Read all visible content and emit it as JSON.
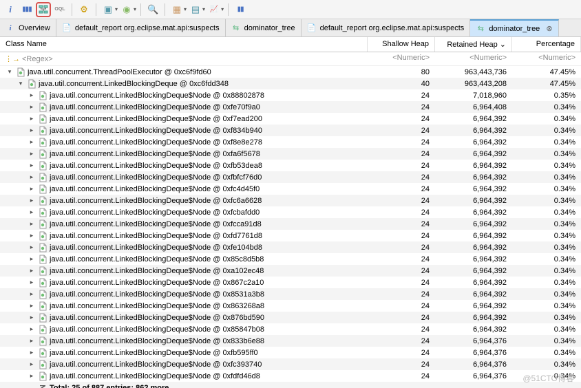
{
  "toolbar": {
    "icons": [
      {
        "name": "info-icon",
        "glyph": "i"
      },
      {
        "name": "histogram-icon",
        "glyph": "▮▮▮"
      },
      {
        "name": "dominator-tree-icon",
        "glyph": "⇆",
        "highlighted": true
      },
      {
        "name": "oql-icon",
        "glyph": "OQL"
      },
      {
        "name": "gear-icon",
        "glyph": "⚙"
      },
      {
        "name": "compare-icon",
        "glyph": "▣"
      },
      {
        "name": "thread-icon",
        "glyph": "◉"
      },
      {
        "name": "search-icon",
        "glyph": "🔍"
      },
      {
        "name": "group-icon",
        "glyph": "▦"
      },
      {
        "name": "calculate-icon",
        "glyph": "▤"
      },
      {
        "name": "chart-icon",
        "glyph": "📈"
      },
      {
        "name": "bar-icon",
        "glyph": "▮▮"
      }
    ]
  },
  "tabs": [
    {
      "icon": "i",
      "label": "Overview",
      "icon_color": "#4a73c4"
    },
    {
      "icon": "📄",
      "label": "default_report  org.eclipse.mat.api:suspects",
      "icon_color": "#6b8"
    },
    {
      "icon": "⇆",
      "label": "dominator_tree",
      "icon_color": "#6b8"
    },
    {
      "icon": "📄",
      "label": "default_report  org.eclipse.mat.api:suspects",
      "icon_color": "#6b8"
    },
    {
      "icon": "⇆",
      "label": "dominator_tree",
      "active": true,
      "closable": true,
      "icon_color": "#6b8"
    }
  ],
  "columns": {
    "name": "Class Name",
    "shallow": "Shallow Heap",
    "retained": "Retained Heap ⌄",
    "percent": "Percentage"
  },
  "filter": {
    "regex": "<Regex>",
    "numeric": "<Numeric>"
  },
  "rows": [
    {
      "indent": 0,
      "exp": "▾",
      "label": "java.util.concurrent.ThreadPoolExecutor @ 0xc6f9fd60",
      "shallow": "80",
      "retained": "963,443,736",
      "percent": "47.45%"
    },
    {
      "indent": 1,
      "exp": "▾",
      "label": "java.util.concurrent.LinkedBlockingDeque @ 0xc6fdd348",
      "shallow": "40",
      "retained": "963,443,208",
      "percent": "47.45%"
    },
    {
      "indent": 2,
      "exp": "▸",
      "label": "java.util.concurrent.LinkedBlockingDeque$Node @ 0x88802878",
      "shallow": "24",
      "retained": "7,018,960",
      "percent": "0.35%"
    },
    {
      "indent": 2,
      "exp": "▸",
      "label": "java.util.concurrent.LinkedBlockingDeque$Node @ 0xfe70f9a0",
      "shallow": "24",
      "retained": "6,964,408",
      "percent": "0.34%"
    },
    {
      "indent": 2,
      "exp": "▸",
      "label": "java.util.concurrent.LinkedBlockingDeque$Node @ 0xf7ead200",
      "shallow": "24",
      "retained": "6,964,392",
      "percent": "0.34%"
    },
    {
      "indent": 2,
      "exp": "▸",
      "label": "java.util.concurrent.LinkedBlockingDeque$Node @ 0xf834b940",
      "shallow": "24",
      "retained": "6,964,392",
      "percent": "0.34%"
    },
    {
      "indent": 2,
      "exp": "▸",
      "label": "java.util.concurrent.LinkedBlockingDeque$Node @ 0xf8e8e278",
      "shallow": "24",
      "retained": "6,964,392",
      "percent": "0.34%"
    },
    {
      "indent": 2,
      "exp": "▸",
      "label": "java.util.concurrent.LinkedBlockingDeque$Node @ 0xfa6f5678",
      "shallow": "24",
      "retained": "6,964,392",
      "percent": "0.34%"
    },
    {
      "indent": 2,
      "exp": "▸",
      "label": "java.util.concurrent.LinkedBlockingDeque$Node @ 0xfb53dea8",
      "shallow": "24",
      "retained": "6,964,392",
      "percent": "0.34%"
    },
    {
      "indent": 2,
      "exp": "▸",
      "label": "java.util.concurrent.LinkedBlockingDeque$Node @ 0xfbfcf76d0",
      "shallow": "24",
      "retained": "6,964,392",
      "percent": "0.34%"
    },
    {
      "indent": 2,
      "exp": "▸",
      "label": "java.util.concurrent.LinkedBlockingDeque$Node @ 0xfc4d45f0",
      "shallow": "24",
      "retained": "6,964,392",
      "percent": "0.34%"
    },
    {
      "indent": 2,
      "exp": "▸",
      "label": "java.util.concurrent.LinkedBlockingDeque$Node @ 0xfc6a6628",
      "shallow": "24",
      "retained": "6,964,392",
      "percent": "0.34%"
    },
    {
      "indent": 2,
      "exp": "▸",
      "label": "java.util.concurrent.LinkedBlockingDeque$Node @ 0xfcbafdd0",
      "shallow": "24",
      "retained": "6,964,392",
      "percent": "0.34%"
    },
    {
      "indent": 2,
      "exp": "▸",
      "label": "java.util.concurrent.LinkedBlockingDeque$Node @ 0xfcca91d8",
      "shallow": "24",
      "retained": "6,964,392",
      "percent": "0.34%"
    },
    {
      "indent": 2,
      "exp": "▸",
      "label": "java.util.concurrent.LinkedBlockingDeque$Node @ 0xfd7761d8",
      "shallow": "24",
      "retained": "6,964,392",
      "percent": "0.34%"
    },
    {
      "indent": 2,
      "exp": "▸",
      "label": "java.util.concurrent.LinkedBlockingDeque$Node @ 0xfe104bd8",
      "shallow": "24",
      "retained": "6,964,392",
      "percent": "0.34%"
    },
    {
      "indent": 2,
      "exp": "▸",
      "label": "java.util.concurrent.LinkedBlockingDeque$Node @ 0x85c8d5b8",
      "shallow": "24",
      "retained": "6,964,392",
      "percent": "0.34%"
    },
    {
      "indent": 2,
      "exp": "▸",
      "label": "java.util.concurrent.LinkedBlockingDeque$Node @ 0xa102ec48",
      "shallow": "24",
      "retained": "6,964,392",
      "percent": "0.34%"
    },
    {
      "indent": 2,
      "exp": "▸",
      "label": "java.util.concurrent.LinkedBlockingDeque$Node @ 0x867c2a10",
      "shallow": "24",
      "retained": "6,964,392",
      "percent": "0.34%"
    },
    {
      "indent": 2,
      "exp": "▸",
      "label": "java.util.concurrent.LinkedBlockingDeque$Node @ 0x8531a3b8",
      "shallow": "24",
      "retained": "6,964,392",
      "percent": "0.34%"
    },
    {
      "indent": 2,
      "exp": "▸",
      "label": "java.util.concurrent.LinkedBlockingDeque$Node @ 0x863268a8",
      "shallow": "24",
      "retained": "6,964,392",
      "percent": "0.34%"
    },
    {
      "indent": 2,
      "exp": "▸",
      "label": "java.util.concurrent.LinkedBlockingDeque$Node @ 0x876bd590",
      "shallow": "24",
      "retained": "6,964,392",
      "percent": "0.34%"
    },
    {
      "indent": 2,
      "exp": "▸",
      "label": "java.util.concurrent.LinkedBlockingDeque$Node @ 0x85847b08",
      "shallow": "24",
      "retained": "6,964,392",
      "percent": "0.34%"
    },
    {
      "indent": 2,
      "exp": "▸",
      "label": "java.util.concurrent.LinkedBlockingDeque$Node @ 0x833b6e88",
      "shallow": "24",
      "retained": "6,964,376",
      "percent": "0.34%"
    },
    {
      "indent": 2,
      "exp": "▸",
      "label": "java.util.concurrent.LinkedBlockingDeque$Node @ 0xfb595ff0",
      "shallow": "24",
      "retained": "6,964,376",
      "percent": "0.34%"
    },
    {
      "indent": 2,
      "exp": "▸",
      "label": "java.util.concurrent.LinkedBlockingDeque$Node @ 0xfc393740",
      "shallow": "24",
      "retained": "6,964,376",
      "percent": "0.34%"
    },
    {
      "indent": 2,
      "exp": "▸",
      "label": "java.util.concurrent.LinkedBlockingDeque$Node @ 0xfdfd46d8",
      "shallow": "24",
      "retained": "6,964,376",
      "percent": "0.34%"
    }
  ],
  "total_row": {
    "label": "Total: 25 of 887 entries; 862 more"
  },
  "watermark": "@51CTO博客"
}
